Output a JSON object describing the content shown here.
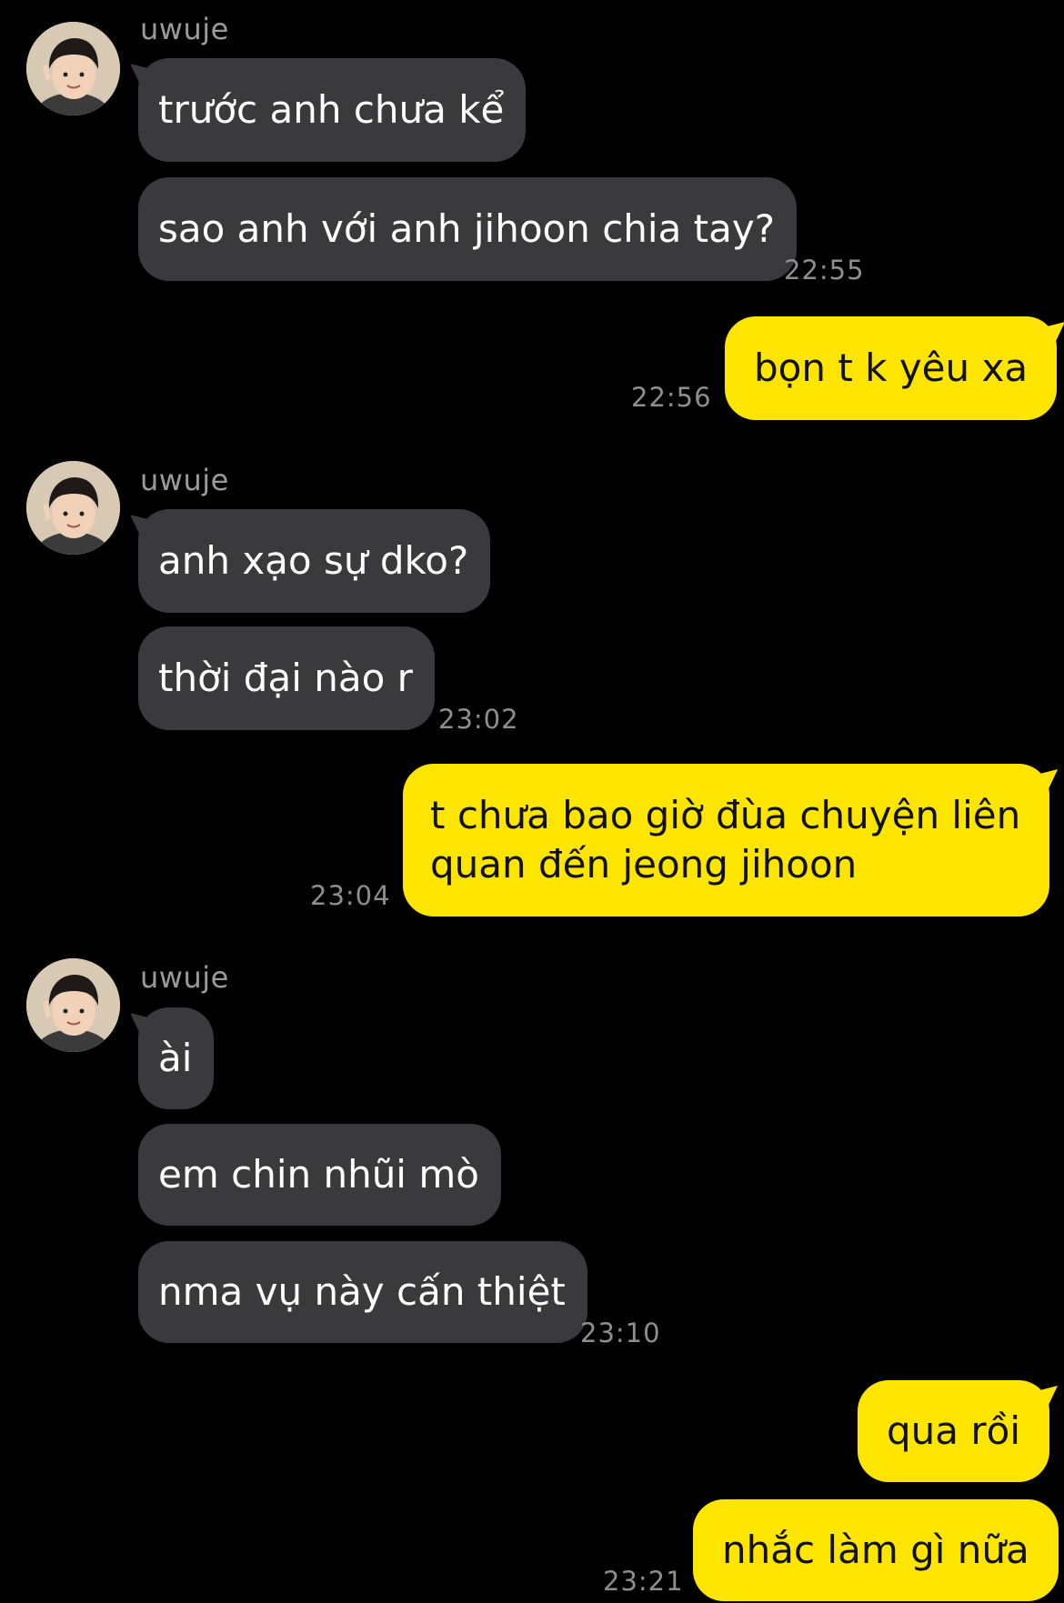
{
  "contact": {
    "name": "uwuje",
    "avatar_icon": "child-avatar-icon"
  },
  "colors": {
    "background": "#000000",
    "incoming_bubble": "#3a3a3c",
    "outgoing_bubble": "#fee500",
    "timestamp": "#8e8e8e"
  },
  "messages": [
    {
      "sender": "uwuje",
      "text": "trước anh chưa kể"
    },
    {
      "sender": "uwuje",
      "text": "sao anh với anh jihoon chia tay?",
      "time": "22:55"
    },
    {
      "sender": "me",
      "text": "bọn t k yêu xa",
      "time": "22:56"
    },
    {
      "sender": "uwuje",
      "text": "anh xạo sự dko?"
    },
    {
      "sender": "uwuje",
      "text": "thời đại nào r",
      "time": "23:02"
    },
    {
      "sender": "me",
      "text": "t chưa bao giờ đùa chuyện liên\nquan đến jeong jihoon",
      "time": "23:04"
    },
    {
      "sender": "uwuje",
      "text": "ài"
    },
    {
      "sender": "uwuje",
      "text": "em chin nhũi mò"
    },
    {
      "sender": "uwuje",
      "text": "nma vụ này cấn thiệt",
      "time": "23:10"
    },
    {
      "sender": "me",
      "text": "qua rồi"
    },
    {
      "sender": "me",
      "text": "nhắc làm gì nữa",
      "time": "23:21"
    }
  ]
}
